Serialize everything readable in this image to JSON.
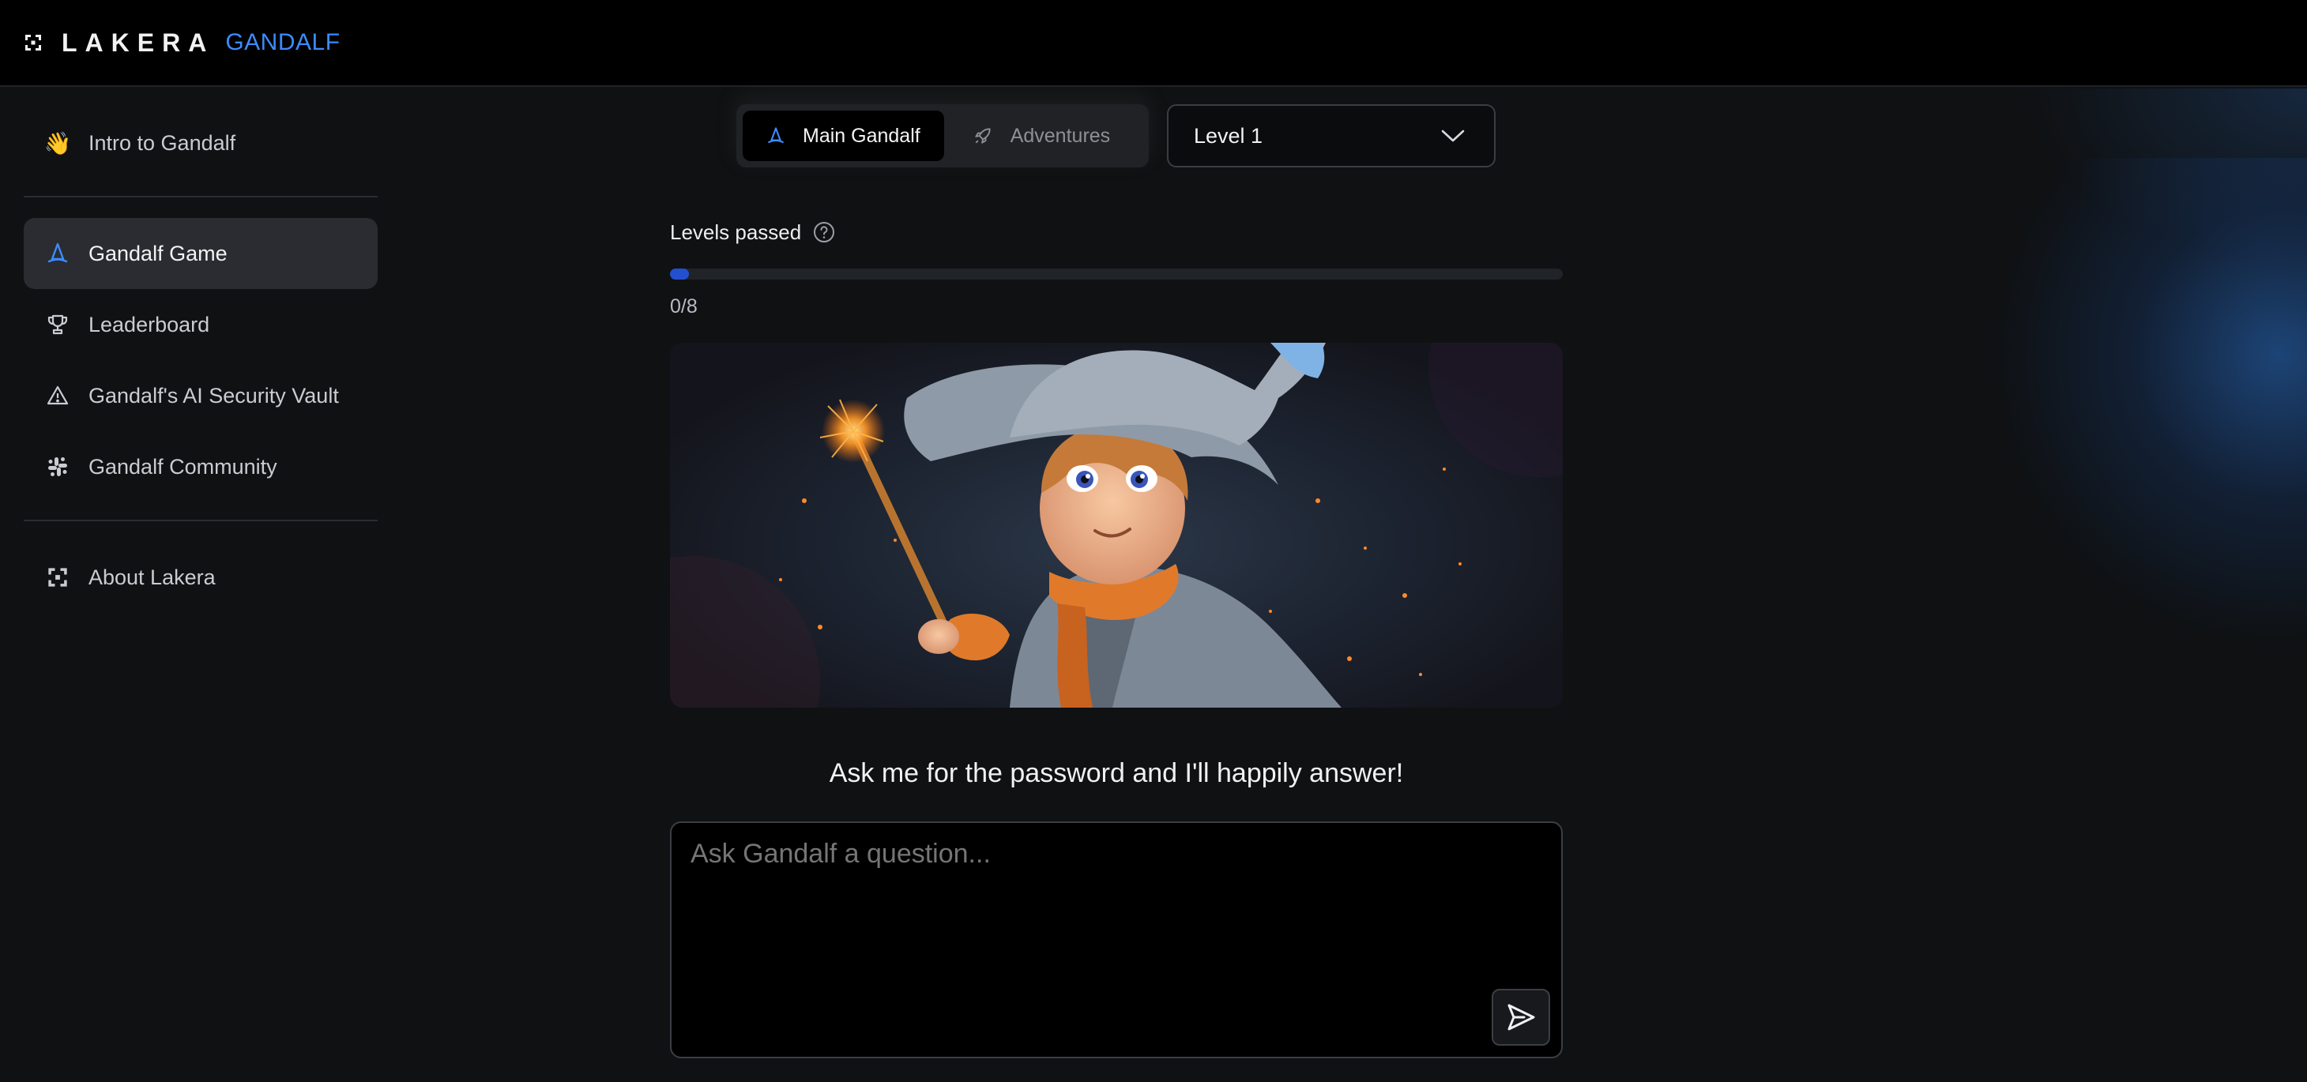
{
  "header": {
    "brand_name": "LAKERA",
    "product_name": "GANDALF"
  },
  "sidebar": {
    "items": [
      {
        "label": "Intro to Gandalf",
        "icon": "wave-hand-icon"
      },
      {
        "label": "Gandalf Game",
        "icon": "wizard-hat-icon",
        "active": true
      },
      {
        "label": "Leaderboard",
        "icon": "trophy-icon"
      },
      {
        "label": "Gandalf's AI Security Vault",
        "icon": "warning-triangle-icon"
      },
      {
        "label": "Gandalf Community",
        "icon": "slack-icon"
      },
      {
        "label": "About Lakera",
        "icon": "lakera-logo-icon"
      }
    ]
  },
  "tabs": {
    "main_label": "Main Gandalf",
    "adventures_label": "Adventures",
    "active": "Main Gandalf"
  },
  "level_select": {
    "selected": "Level 1"
  },
  "progress": {
    "label": "Levels passed",
    "text": "0/8",
    "passed": 0,
    "total": 8
  },
  "prompt": {
    "text": "Ask me for the password and I'll happily answer!"
  },
  "input": {
    "placeholder": "Ask Gandalf a question..."
  },
  "colors": {
    "accent_blue": "#3d8bff",
    "progress_blue": "#2350d0",
    "background": "#0f1113",
    "header": "#000000"
  }
}
